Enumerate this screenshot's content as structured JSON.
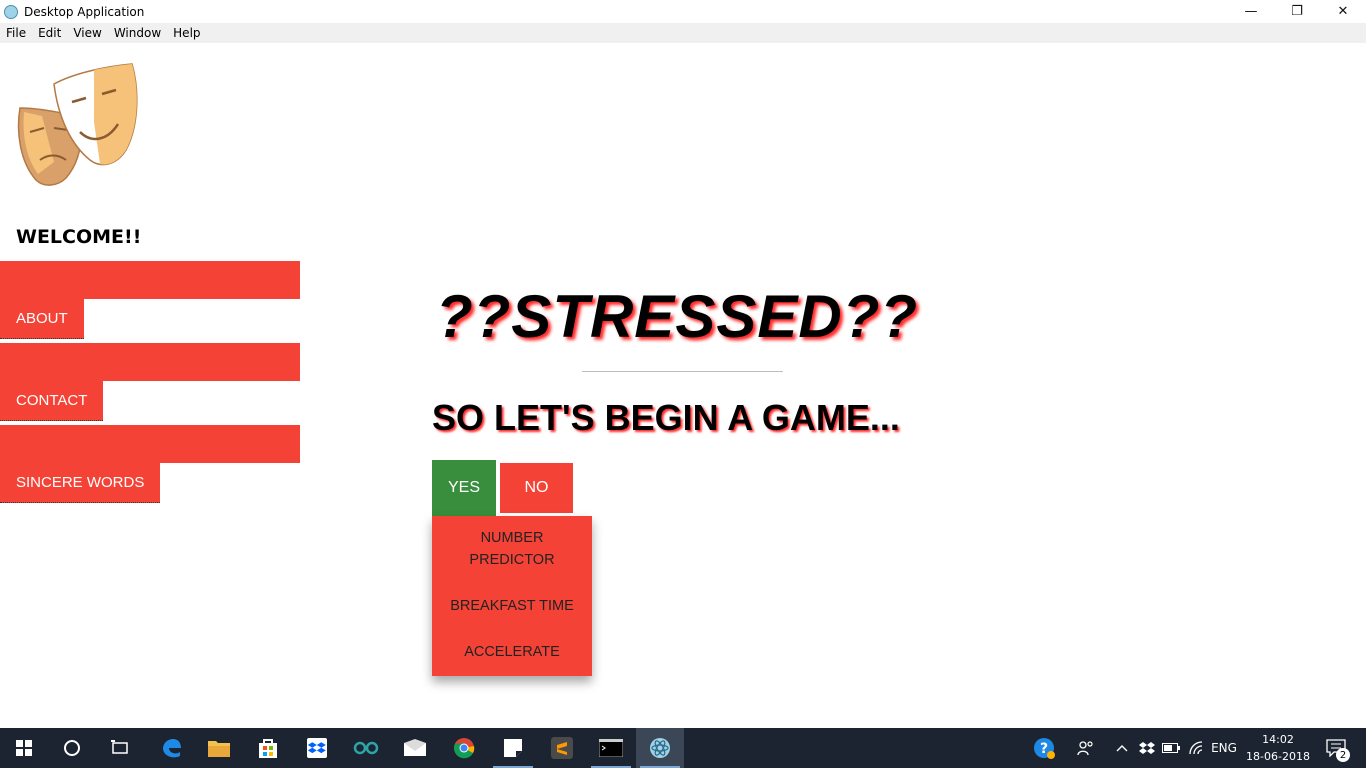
{
  "window": {
    "title": "Desktop Application",
    "controls": {
      "minimize": "—",
      "restore": "❐",
      "close": "✕"
    }
  },
  "menu": [
    "File",
    "Edit",
    "View",
    "Window",
    "Help"
  ],
  "sidebar": {
    "welcome": "WELCOME!!",
    "items": [
      {
        "label": "ABOUT"
      },
      {
        "label": "CONTACT"
      },
      {
        "label": "SINCERE WORDS"
      }
    ]
  },
  "main": {
    "headline": "??STRESSED??",
    "subhead": "SO LET'S BEGIN A GAME...",
    "yes_label": "YES",
    "no_label": "NO",
    "dropdown": [
      "NUMBER PREDICTOR",
      "BREAKFAST TIME",
      "ACCELERATE"
    ]
  },
  "colors": {
    "accent_red": "#f44336",
    "yes_green": "#388e3c",
    "taskbar": "#1b2430"
  },
  "taskbar": {
    "apps": [
      "start-icon",
      "cortana-icon",
      "task-view-icon",
      "edge-icon",
      "file-explorer-icon",
      "store-icon",
      "dropbox-icon",
      "arduino-icon",
      "mail-icon",
      "chrome-icon",
      "sticky-notes-icon",
      "sublime-icon",
      "terminal-icon",
      "electron-icon"
    ],
    "language": "ENG",
    "time": "14:02",
    "date": "18-06-2018",
    "notification_count": "2"
  }
}
